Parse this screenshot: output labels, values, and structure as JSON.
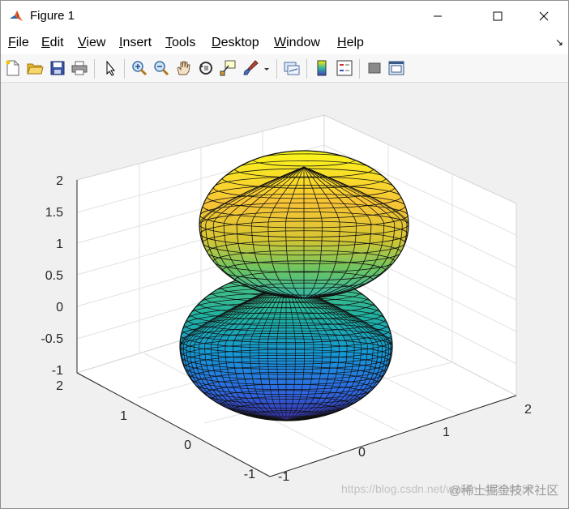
{
  "window": {
    "title": "Figure 1"
  },
  "menu": [
    {
      "pre": "",
      "u": "F",
      "post": "ile"
    },
    {
      "pre": "",
      "u": "E",
      "post": "dit"
    },
    {
      "pre": "",
      "u": "V",
      "post": "iew"
    },
    {
      "pre": "",
      "u": "I",
      "post": "nsert"
    },
    {
      "pre": "",
      "u": "T",
      "post": "ools"
    },
    {
      "pre": "",
      "u": "D",
      "post": "esktop"
    },
    {
      "pre": "",
      "u": "W",
      "post": "indow"
    },
    {
      "pre": "",
      "u": "H",
      "post": "elp"
    }
  ],
  "toolbar_icons": [
    "new-figure-icon",
    "open-file-icon",
    "save-icon",
    "print-icon",
    "pointer-icon",
    "zoom-in-icon",
    "zoom-out-icon",
    "pan-icon",
    "rotate-3d-icon",
    "data-cursor-icon",
    "brush-icon",
    "brush-dropdown-icon",
    "link-plot-icon",
    "colorbar-icon",
    "legend-icon",
    "hide-plot-tools-icon",
    "show-plot-tools-icon"
  ],
  "axes": {
    "z_ticks": [
      "2",
      "1.5",
      "1",
      "0.5",
      "0",
      "-0.5",
      "-1"
    ],
    "y_ticks": [
      "2",
      "1",
      "0",
      "-1"
    ],
    "x_ticks": [
      "-1",
      "0",
      "1",
      "2"
    ]
  },
  "watermark": {
    "url": "https://blog.csdn.net/weixin_46258937",
    "site": "@稀土掘金技术社区"
  },
  "colors": {
    "colormap": "parula",
    "background": "#f0f0f0"
  }
}
